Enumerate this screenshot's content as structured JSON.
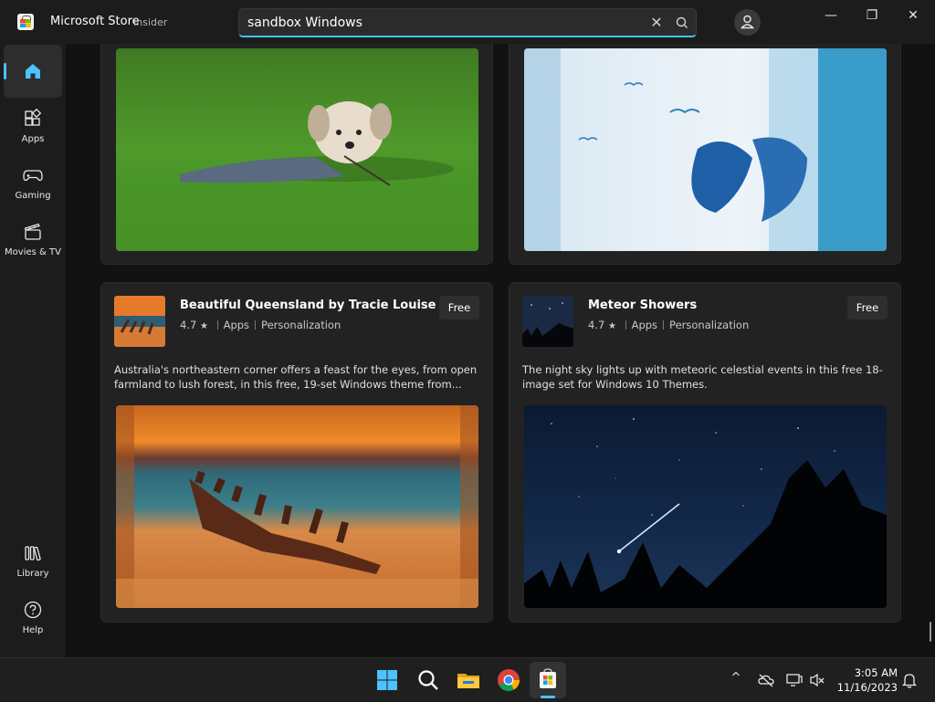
{
  "window": {
    "title": "Microsoft Store",
    "badge": "Insider",
    "minimize": "—",
    "restore": "❐",
    "close": "✕"
  },
  "search": {
    "value": "sandbox Windows",
    "clear": "✕"
  },
  "sidebar": {
    "items": [
      {
        "label": ""
      },
      {
        "label": "Apps"
      },
      {
        "label": "Gaming"
      },
      {
        "label": "Movies & TV"
      },
      {
        "label": "Library"
      },
      {
        "label": "Help"
      }
    ]
  },
  "cards": [
    {
      "title": "Beautiful Queensland by Tracie Louise",
      "rating": "4.7",
      "category": "Apps",
      "subcategory": "Personalization",
      "price": "Free",
      "description": "Australia's northeastern corner offers a feast for the eyes, from open farmland to lush forest, in this free, 19-set Windows theme from..."
    },
    {
      "title": "Meteor Showers",
      "rating": "4.7",
      "category": "Apps",
      "subcategory": "Personalization",
      "price": "Free",
      "description": "The night sky lights up with meteoric celestial events in this free 18-image set for Windows 10 Themes."
    }
  ],
  "taskbar": {
    "time": "3:05 AM",
    "date": "11/16/2023",
    "tray_chevron": "^"
  },
  "colors": {
    "accent": "#4cc2ff",
    "background": "#121212",
    "card": "#222222"
  }
}
